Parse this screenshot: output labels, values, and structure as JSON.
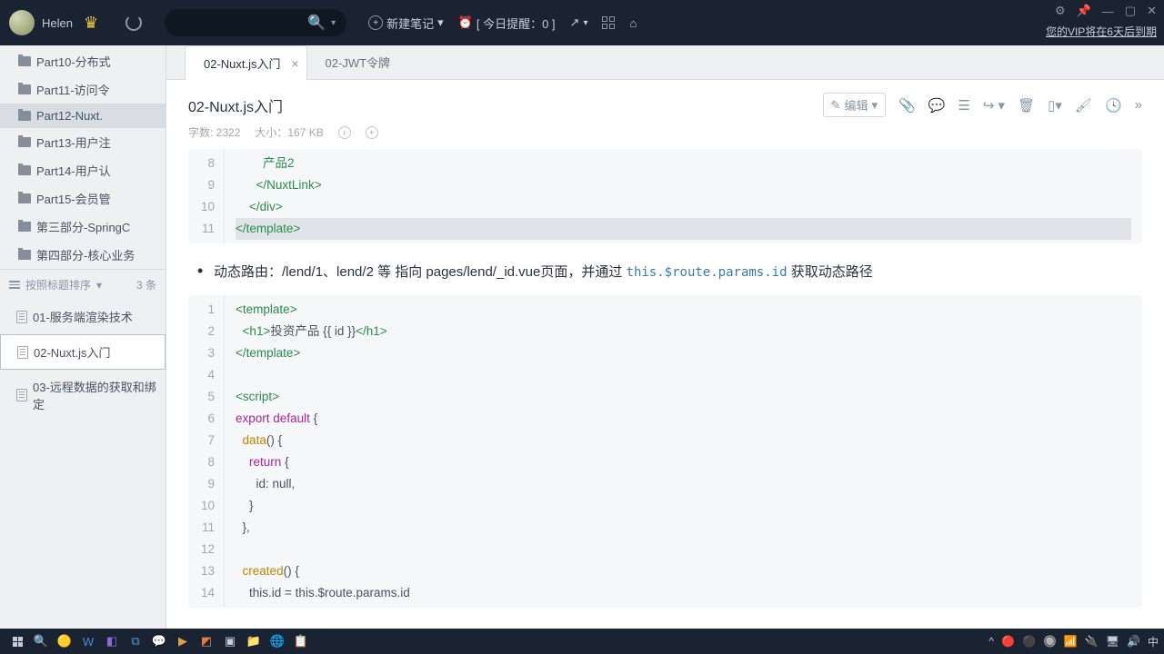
{
  "titlebar": {
    "username": "Helen",
    "new_note": "新建笔记",
    "reminder": "[ 今日提醒：0 ]",
    "vip_notice": "您的VIP将在6天后到期"
  },
  "sidebar": {
    "folders": [
      {
        "label": "Part10-分布式"
      },
      {
        "label": "Part11-访问令"
      },
      {
        "label": "Part12-Nuxt."
      },
      {
        "label": "Part13-用户注"
      },
      {
        "label": "Part14-用户认"
      },
      {
        "label": "Part15-会员管"
      },
      {
        "label": "第三部分-SpringC"
      },
      {
        "label": "第四部分-核心业务"
      }
    ],
    "sort_label": "按照标题排序",
    "count": "3 条",
    "notes": [
      {
        "label": "01-服务端渲染技术"
      },
      {
        "label": "02-Nuxt.js入门"
      },
      {
        "label": "03-远程数据的获取和绑定"
      }
    ]
  },
  "tabs": [
    {
      "label": "02-Nuxt.js入门",
      "active": true
    },
    {
      "label": "02-JWT令牌",
      "active": false
    }
  ],
  "doc": {
    "title": "02-Nuxt.js入门",
    "edit_label": "编辑",
    "char_count": "字数: 2322",
    "size": "大小：167 KB"
  },
  "code1": {
    "start": 8,
    "lines": [
      "        产品2",
      "      </NuxtLink>",
      "    </div>",
      "</template>"
    ]
  },
  "bullet": {
    "prefix": "动态路由：/lend/1、lend/2 等 指向 pages/lend/_id.vue页面，并通过 ",
    "code": "this.$route.params.id",
    "suffix": " 获取动态路径"
  },
  "code2": {
    "start": 1,
    "lines": [
      {
        "t": "<template>",
        "c": "tag"
      },
      {
        "t": "  <h1>投资产品 {{ id }}</h1>",
        "c": "mixed"
      },
      {
        "t": "</template>",
        "c": "tag"
      },
      {
        "t": "",
        "c": ""
      },
      {
        "t": "<script>",
        "c": "tag"
      },
      {
        "t": "export default {",
        "c": "kw"
      },
      {
        "t": "  data() {",
        "c": "fn"
      },
      {
        "t": "    return {",
        "c": "kw2"
      },
      {
        "t": "      id: null,",
        "c": "plain"
      },
      {
        "t": "    }",
        "c": "plain"
      },
      {
        "t": "  },",
        "c": "plain"
      },
      {
        "t": "",
        "c": ""
      },
      {
        "t": "  created() {",
        "c": "fn"
      },
      {
        "t": "    this.id = this.$route.params.id",
        "c": "plain"
      }
    ]
  }
}
